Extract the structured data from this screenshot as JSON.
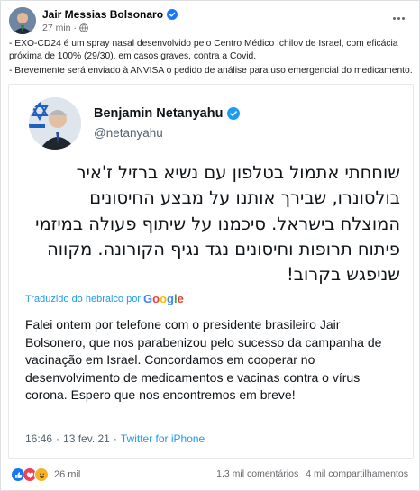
{
  "post": {
    "author": "Jair Messias Bolsonaro",
    "time": "27 min",
    "caption_lines": [
      "- EXO-CD24 é um spray nasal desenvolvido pelo Centro Médico Ichilov de Israel, com eficácia próxima de 100% (29/30), em casos graves, contra a Covid.",
      "- Brevemente será enviado à ANVISA o pedido de análise para uso emergencial do medicamento."
    ]
  },
  "tweet": {
    "name": "Benjamin Netanyahu",
    "handle": "@netanyahu",
    "hebrew_text": "שוחחתי אתמול בטלפון עם נשיא ברזיל ז'איר בולסונרו, שבירך אותנו על מבצע החיסונים המוצלח בישראל. סיכמנו על שיתוף פעולה במיזמי פיתוח תרופות וחיסונים נגד נגיף הקורונה. מקווה שניפגש בקרוב!",
    "translated_label": "Traduzido do hebraico por",
    "translated_by": "Google",
    "translation": "Falei ontem por telefone com o presidente brasileiro Jair Bolsonero, que nos parabenizou pelo sucesso da campanha de vacinação em Israel. Concordamos em cooperar no desenvolvimento de medicamentos e vacinas contra o vírus corona. Espero que nos encontremos em breve!",
    "time": "16:46",
    "date": "13 fev. 21",
    "source": "Twitter for iPhone"
  },
  "footer": {
    "reactions_count": "26 mil",
    "comments": "1,3 mil comentários",
    "shares": "4 mil compartilhamentos"
  },
  "colors": {
    "facebook_blue": "#1877f2",
    "twitter_blue": "#1d9bf0",
    "love_red": "#f33e58",
    "haha_yellow": "#f7b125"
  },
  "icons": [
    "verified-badge-icon",
    "globe-icon",
    "more-options-icon",
    "like-reaction-icon",
    "love-reaction-icon",
    "haha-reaction-icon"
  ]
}
